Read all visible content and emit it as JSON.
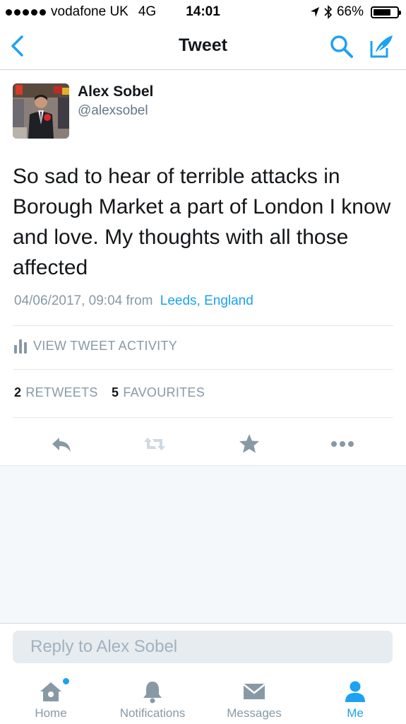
{
  "status_bar": {
    "carrier": "vodafone UK",
    "network": "4G",
    "time": "14:01",
    "battery": "66%"
  },
  "nav": {
    "title": "Tweet",
    "back_icon": "chevron-left-icon",
    "search_icon": "search-icon",
    "compose_icon": "compose-icon"
  },
  "tweet": {
    "author_name": "Alex Sobel",
    "author_handle": "@alexsobel",
    "text": "So sad to hear of terrible attacks in Borough Market a part of London I know and love. My thoughts with all those affected",
    "timestamp": "04/06/2017, 09:04",
    "from_label": "from",
    "location": "Leeds, England",
    "activity_label": "VIEW TWEET ACTIVITY",
    "retweets_count": "2",
    "retweets_label": "RETWEETS",
    "favourites_count": "5",
    "favourites_label": "FAVOURITES"
  },
  "actions": [
    "reply-icon",
    "retweet-icon",
    "favourite-icon",
    "more-icon"
  ],
  "reply": {
    "placeholder": "Reply to Alex Sobel"
  },
  "tabs": [
    {
      "label": "Home",
      "icon": "home-icon",
      "active": false
    },
    {
      "label": "Notifications",
      "icon": "bell-icon",
      "active": false
    },
    {
      "label": "Messages",
      "icon": "envelope-icon",
      "active": false
    },
    {
      "label": "Me",
      "icon": "person-icon",
      "active": true
    }
  ],
  "colors": {
    "accent": "#1da1f2",
    "muted": "#8899a6",
    "text": "#14171a",
    "background_gray": "#f5f8fa"
  }
}
